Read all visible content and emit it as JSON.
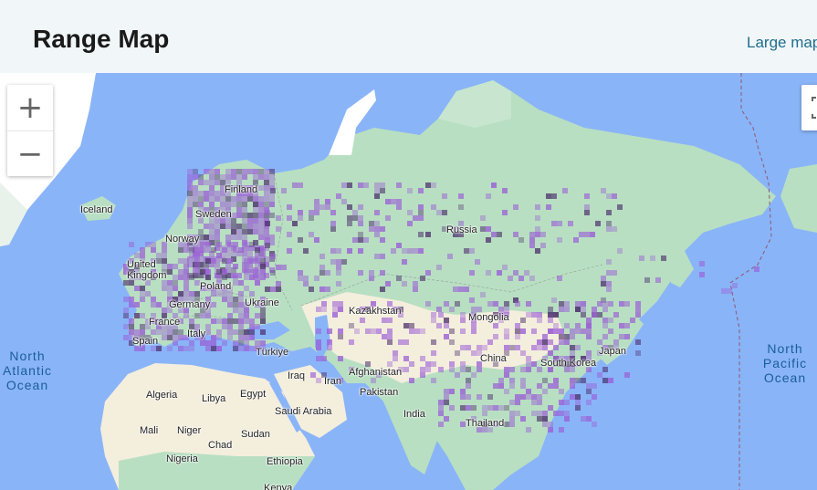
{
  "header": {
    "title": "Range Map",
    "large_map_link": "Large map"
  },
  "map": {
    "zoom_in_label": "+",
    "zoom_out_label": "−",
    "country_labels": [
      "Iceland",
      "Finland",
      "Sweden",
      "Norway",
      "Russia",
      "United Kingdom",
      "Poland",
      "Germany",
      "Ukraine",
      "France",
      "Kazakhstan",
      "Mongolia",
      "Italy",
      "Spain",
      "Türkiye",
      "Japan",
      "Iraq",
      "Iran",
      "Afghanistan",
      "China",
      "South Korea",
      "Algeria",
      "Libya",
      "Egypt",
      "Pakistan",
      "Saudi Arabia",
      "India",
      "Thailand",
      "Mali",
      "Niger",
      "Sudan",
      "Chad",
      "Nigeria",
      "Ethiopia",
      "Kenya"
    ],
    "ocean_labels": [
      "North Atlantic Ocean",
      "North Pacific Ocean"
    ],
    "colors": {
      "water": "#8ab4f8",
      "land": "#b8dfc2",
      "desert": "#f4eedd",
      "snow": "#ffffff",
      "range": "#9a5cd6",
      "range_dark": "#4b2d6b"
    }
  }
}
